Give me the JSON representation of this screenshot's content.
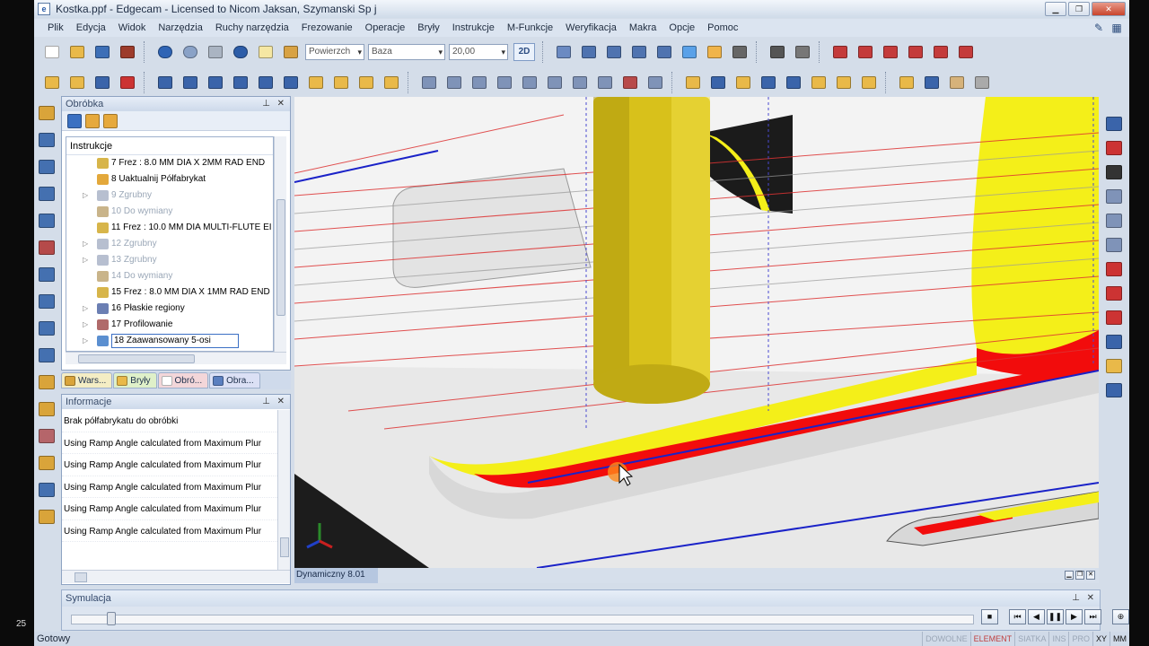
{
  "window": {
    "title": "Kostka.ppf - Edgecam - Licensed to Nicom Jaksan, Szymanski Sp j",
    "desktop_number": "25"
  },
  "menu": [
    "Plik",
    "Edycja",
    "Widok",
    "Narzędzia",
    "Ruchy narzędzia",
    "Frezowanie",
    "Operacje",
    "Bryły",
    "Instrukcje",
    "M-Funkcje",
    "Weryfikacja",
    "Makra",
    "Opcje",
    "Pomoc"
  ],
  "toolbar": {
    "combo_filter": "Powierzch",
    "combo_ref": "Baza",
    "combo_value": "20,00",
    "view_2d": "2D"
  },
  "obrobka": {
    "title": "Obróbka",
    "tree_header": "Instrukcje",
    "rows": [
      {
        "label": "7 Frez : 8.0 MM DIA X 2MM RAD END",
        "icon": "tool-icon",
        "color": "#d7b54a",
        "dim": false,
        "expand": ""
      },
      {
        "label": "8 Uaktualnij Półfabrykat",
        "icon": "stock-update-icon",
        "color": "#e3a83b",
        "dim": false,
        "expand": ""
      },
      {
        "label": "9 Zgrubny",
        "icon": "roughing-icon",
        "color": "#b7bfd0",
        "dim": true,
        "expand": "▷"
      },
      {
        "label": "10 Do wymiany",
        "icon": "tool-change-icon",
        "color": "#c9b48a",
        "dim": true,
        "expand": ""
      },
      {
        "label": "11 Frez : 10.0 MM DIA MULTI-FLUTE EI",
        "icon": "tool-icon",
        "color": "#d7b54a",
        "dim": false,
        "expand": ""
      },
      {
        "label": "12 Zgrubny",
        "icon": "roughing-icon",
        "color": "#b7bfd0",
        "dim": true,
        "expand": "▷"
      },
      {
        "label": "13 Zgrubny",
        "icon": "roughing-icon",
        "color": "#b7bfd0",
        "dim": true,
        "expand": "▷"
      },
      {
        "label": "14 Do wymiany",
        "icon": "tool-change-icon",
        "color": "#c9b48a",
        "dim": true,
        "expand": ""
      },
      {
        "label": "15 Frez : 8.0 MM DIA X 1MM RAD END",
        "icon": "tool-icon",
        "color": "#d7b54a",
        "dim": false,
        "expand": ""
      },
      {
        "label": "16 Płaskie regiony",
        "icon": "flat-regions-icon",
        "color": "#6b7fb3",
        "dim": false,
        "expand": "▷"
      },
      {
        "label": "17 Profilowanie",
        "icon": "profiling-icon",
        "color": "#b06a6a",
        "dim": false,
        "expand": "▷"
      },
      {
        "label": "18 Zaawansowany 5-osi",
        "icon": "five-axis-icon",
        "color": "#5b8fd0",
        "dim": false,
        "expand": "▷",
        "selected": true
      }
    ]
  },
  "tabs": [
    {
      "label": "Wars...",
      "icon": "layers-icon"
    },
    {
      "label": "Bryły",
      "icon": "solids-icon"
    },
    {
      "label": "Obró...",
      "icon": "machining-icon"
    },
    {
      "label": "Obra...",
      "icon": "images-icon"
    }
  ],
  "informacje": {
    "title": "Informacje",
    "lines": [
      "Brak półfabrykatu do obróbki",
      "Using Ramp Angle calculated from Maximum Plur",
      "Using Ramp Angle calculated from Maximum Plur",
      "Using Ramp Angle calculated from Maximum Plur",
      "Using Ramp Angle calculated from Maximum Plur",
      "Using Ramp Angle calculated from Maximum Plur"
    ]
  },
  "viewport": {
    "mode_label": "Dynamiczny 8.01"
  },
  "symulacja": {
    "title": "Symulacja",
    "position": 0.04
  },
  "status": {
    "ready": "Gotowy",
    "indicators": [
      "DOWOLNE",
      "ELEMENT",
      "SIATKA",
      "INS",
      "PRO",
      "XY",
      "MM"
    ]
  },
  "colors": {
    "part_yellow": "#f7f31a",
    "toolpath_red": "#ff0000",
    "toolpath_blue": "#1a22c8",
    "tool_body": "#d8c11b"
  }
}
